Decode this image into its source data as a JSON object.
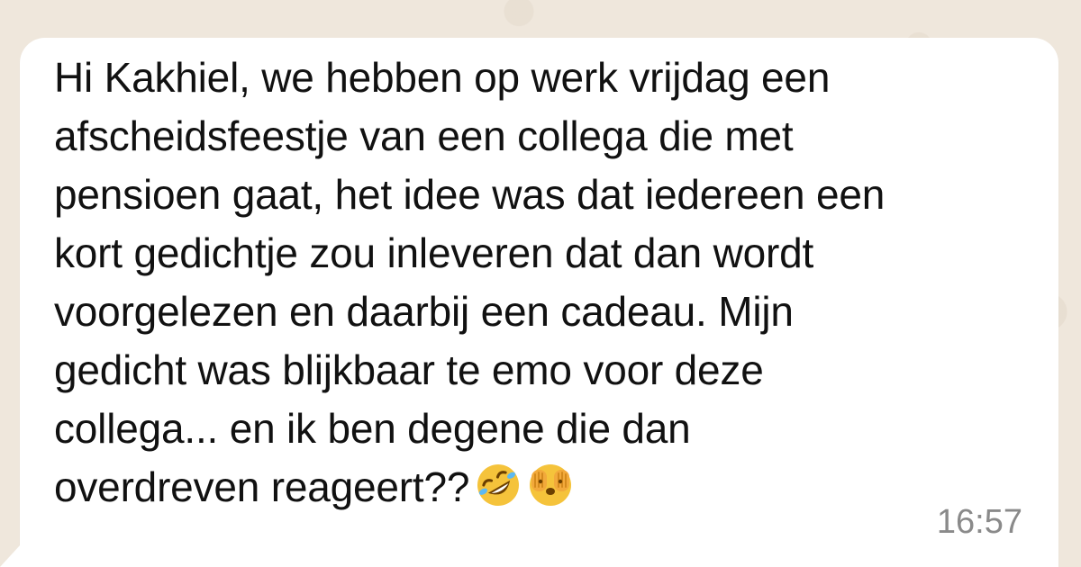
{
  "message": {
    "lines": [
      "Hi Kakhiel, we hebben op werk vrijdag een",
      "afscheidsfeestje van een collega die met",
      "pensioen gaat, het idee was dat iedereen een",
      "kort gedichtje zou inleveren dat dan wordt",
      "voorgelezen en daarbij een cadeau. Mijn",
      "gedicht was blijkbaar te emo voor deze",
      "collega... en ik ben degene die dan",
      "overdreven reageert??"
    ],
    "emojis": [
      "rolling-on-floor-laughing-emoji",
      "face-with-hands-over-eyes-emoji"
    ],
    "time": "16:57"
  },
  "colors": {
    "wallpaper": "#efe7dc",
    "bubble": "#ffffff",
    "text": "#111111",
    "timestamp": "#8a8a8a"
  }
}
